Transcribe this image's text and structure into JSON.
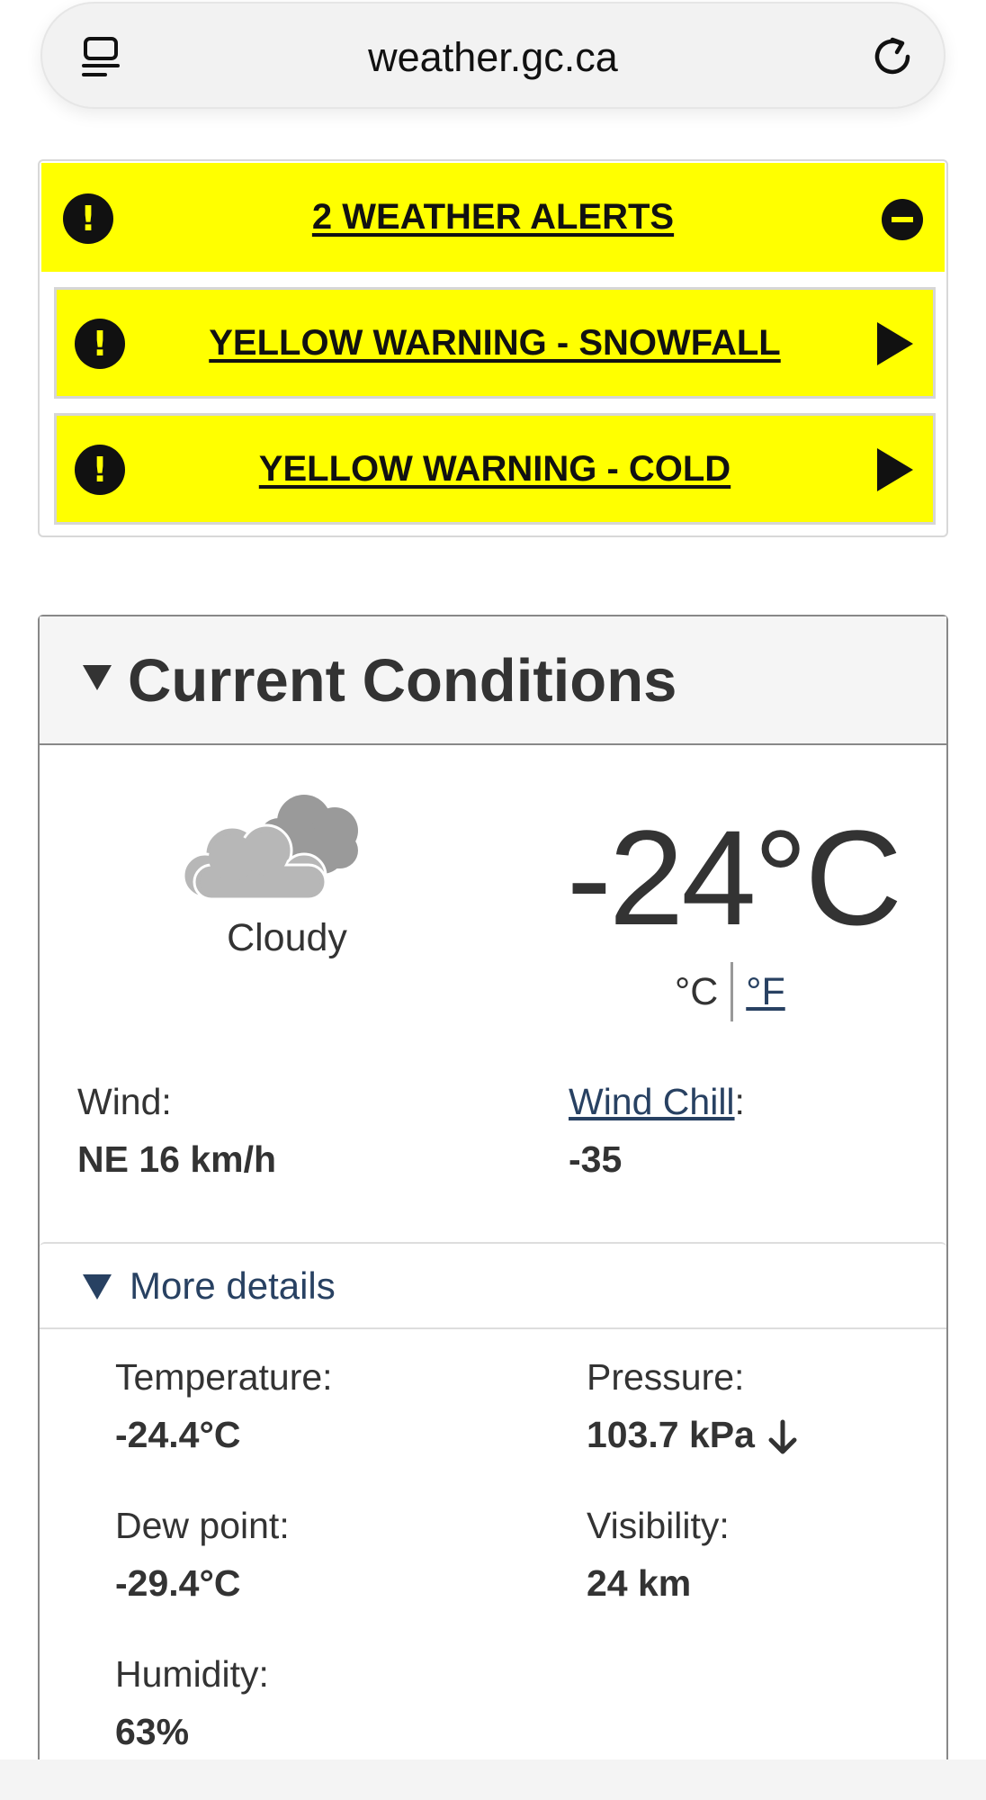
{
  "browser": {
    "url": "weather.gc.ca",
    "reader_icon": "reader-mode-icon",
    "reload_icon": "reload-icon"
  },
  "alerts": {
    "header_title": "2 WEATHER ALERTS",
    "items": [
      {
        "label": "YELLOW WARNING - SNOWFALL"
      },
      {
        "label": "YELLOW WARNING - COLD"
      }
    ],
    "colors": {
      "background": "#ffff00",
      "text": "#111111"
    }
  },
  "current_conditions": {
    "title": "Current Conditions",
    "condition_icon": "cloud-icon",
    "condition": "Cloudy",
    "temperature": "-24°C",
    "unit_c": "°C",
    "unit_f": "°F",
    "wind_label": "Wind:",
    "wind_value": "NE 16 km/h",
    "wind_chill_link": "Wind Chill",
    "wind_chill_colon": ":",
    "wind_chill_value": "-35",
    "more_details_label": "More details",
    "details": {
      "temperature_label": "Temperature:",
      "temperature_value": "-24.4°C",
      "pressure_label": "Pressure:",
      "pressure_value": "103.7 kPa",
      "pressure_trend_icon": "arrow-down-icon",
      "dew_point_label": "Dew point:",
      "dew_point_value": "-29.4°C",
      "visibility_label": "Visibility:",
      "visibility_value": "24 km",
      "humidity_label": "Humidity:",
      "humidity_value": "63%"
    },
    "colors": {
      "link": "#284162",
      "text": "#333333"
    }
  }
}
